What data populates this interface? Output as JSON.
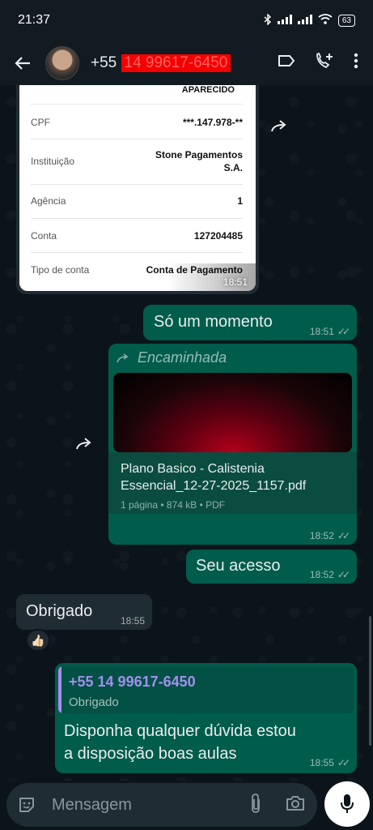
{
  "status_bar": {
    "time": "21:37",
    "battery": "63"
  },
  "header": {
    "contact_prefix": "+55",
    "contact_redacted": "14 99617-6450"
  },
  "receipt": {
    "name_fragment": "APARECIDO",
    "rows": [
      {
        "label": "CPF",
        "value": "***.147.978-**"
      },
      {
        "label": "Instituição",
        "value": "Stone Pagamentos S.A."
      },
      {
        "label": "Agência",
        "value": "1"
      },
      {
        "label": "Conta",
        "value": "127204485"
      },
      {
        "label": "Tipo de conta",
        "value": "Conta de Pagamento"
      }
    ],
    "time": "18:51"
  },
  "messages": {
    "m1": {
      "text": "Só um momento",
      "time": "18:51"
    },
    "m2": {
      "forwarded_label": "Encaminhada",
      "file_name_line1": "Plano Basico - Calistenia",
      "file_name_line2": "Essencial_12-27-2025_1157.pdf",
      "file_meta": "1 página • 874 kB • PDF",
      "time": "18:52"
    },
    "m3": {
      "text": "Seu acesso",
      "time": "18:52"
    },
    "m4": {
      "text": "Obrigado",
      "time": "18:55",
      "reaction": "👍🏻"
    },
    "m5": {
      "quote_author": "+55 14 99617-6450",
      "quote_text": "Obrigado",
      "line1": "Disponha qualquer dúvida estou",
      "line2": "a disposição boas aulas",
      "time": "18:55"
    }
  },
  "input": {
    "placeholder": "Mensagem"
  },
  "colors": {
    "outgoing": "#005c4b",
    "incoming": "#202c33",
    "quote_accent": "#a48ef0"
  }
}
